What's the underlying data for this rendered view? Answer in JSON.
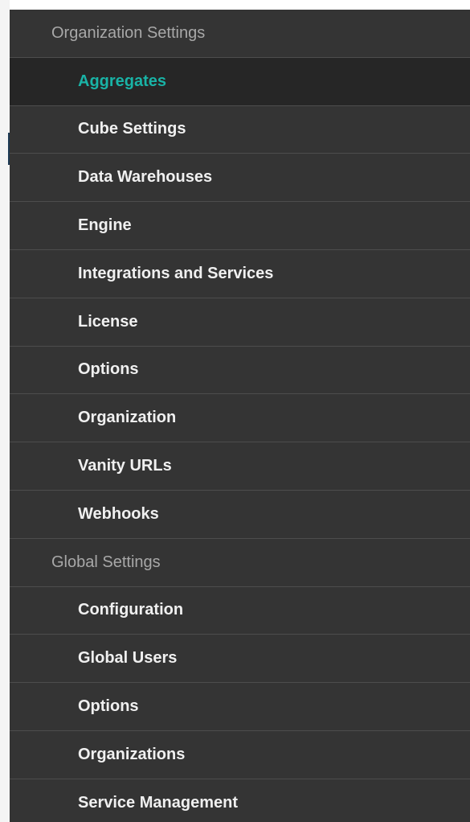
{
  "theme": {
    "background": "#343434",
    "active_background": "#262626",
    "active_text": "#19b3a6",
    "item_text": "#f0f0f0",
    "header_text": "#a8a8a8",
    "divider": "#4d4d4d"
  },
  "organization_settings": {
    "header": "Organization Settings",
    "items": [
      {
        "label": "Aggregates",
        "active": true
      },
      {
        "label": "Cube Settings"
      },
      {
        "label": "Data Warehouses"
      },
      {
        "label": "Engine"
      },
      {
        "label": "Integrations and Services"
      },
      {
        "label": "License"
      },
      {
        "label": "Options"
      },
      {
        "label": "Organization"
      },
      {
        "label": "Vanity URLs"
      },
      {
        "label": "Webhooks"
      }
    ]
  },
  "global_settings": {
    "header": "Global Settings",
    "items": [
      {
        "label": "Configuration"
      },
      {
        "label": "Global Users"
      },
      {
        "label": "Options"
      },
      {
        "label": "Organizations"
      },
      {
        "label": "Service Management"
      }
    ]
  }
}
